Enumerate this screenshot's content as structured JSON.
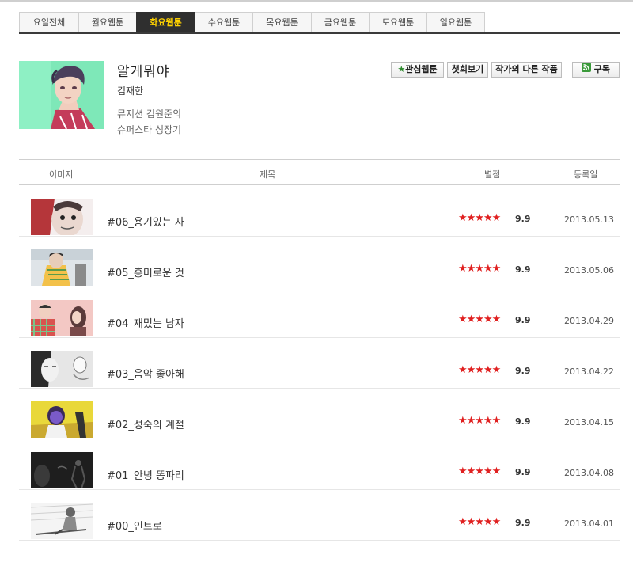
{
  "tabs": [
    {
      "label": "요일전체",
      "active": false
    },
    {
      "label": "월요웹툰",
      "active": false
    },
    {
      "label": "화요웹툰",
      "active": true
    },
    {
      "label": "수요웹툰",
      "active": false
    },
    {
      "label": "목요웹툰",
      "active": false
    },
    {
      "label": "금요웹툰",
      "active": false
    },
    {
      "label": "토요웹툰",
      "active": false
    },
    {
      "label": "일요웹툰",
      "active": false
    }
  ],
  "comic": {
    "title": "알게뭐야",
    "author": "김재한",
    "description_lines": [
      "뮤지션 김원준의",
      "슈퍼스타 성장기"
    ]
  },
  "buttons": {
    "favorite": "관심웹툰",
    "first_episode": "첫회보기",
    "other_works": "작가의 다른 작품",
    "subscribe": "구독"
  },
  "colors": {
    "accent_tab_text": "#ffd200",
    "star": "#e02020",
    "rss": "#3a9a3a"
  },
  "table": {
    "headers": {
      "image": "이미지",
      "title": "제목",
      "rating": "별점",
      "date": "등록일"
    },
    "rows": [
      {
        "title": "#06_용기있는 자",
        "stars": "★★★★★",
        "score": "9.9",
        "date": "2013.05.13"
      },
      {
        "title": "#05_흥미로운 것",
        "stars": "★★★★★",
        "score": "9.9",
        "date": "2013.05.06"
      },
      {
        "title": "#04_재밌는 남자",
        "stars": "★★★★★",
        "score": "9.9",
        "date": "2013.04.29"
      },
      {
        "title": "#03_음악 좋아해",
        "stars": "★★★★★",
        "score": "9.9",
        "date": "2013.04.22"
      },
      {
        "title": "#02_성숙의 계절",
        "stars": "★★★★★",
        "score": "9.9",
        "date": "2013.04.15"
      },
      {
        "title": "#01_안녕 똥파리",
        "stars": "★★★★★",
        "score": "9.9",
        "date": "2013.04.08"
      },
      {
        "title": "#00_인트로",
        "stars": "★★★★★",
        "score": "9.9",
        "date": "2013.04.01"
      }
    ]
  }
}
